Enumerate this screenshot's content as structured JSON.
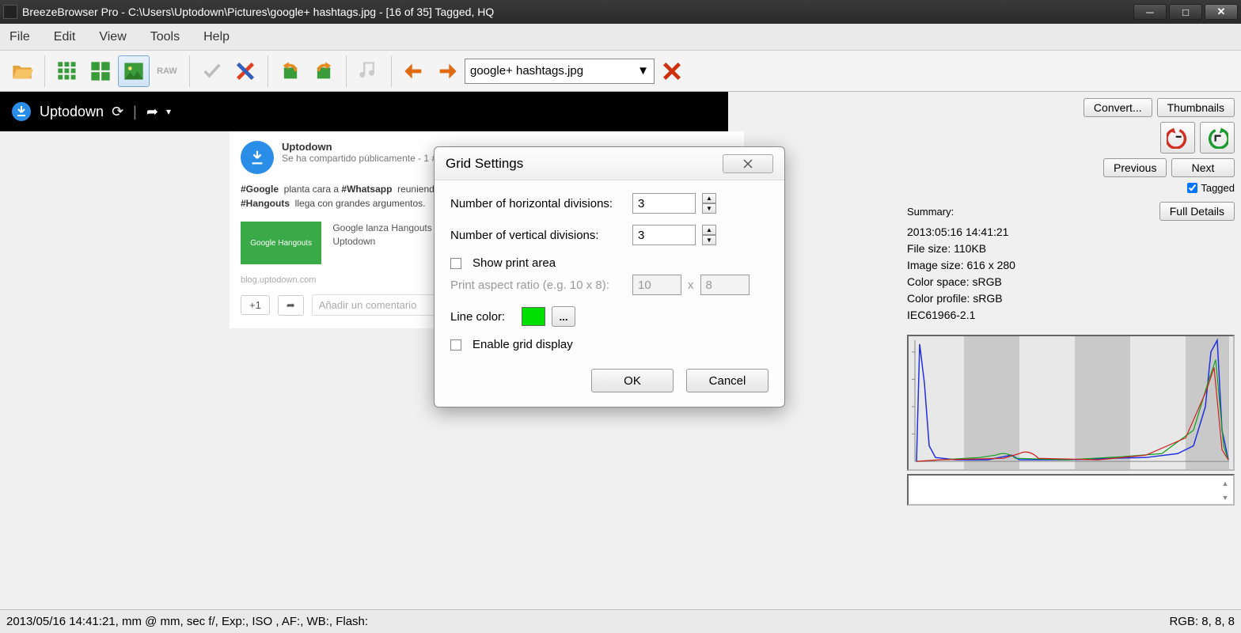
{
  "window": {
    "title": "BreezeBrowser Pro - C:\\Users\\Uptodown\\Pictures\\google+ hashtags.jpg - [16 of 35] Tagged, HQ"
  },
  "menu": {
    "file": "File",
    "edit": "Edit",
    "view": "View",
    "tools": "Tools",
    "help": "Help"
  },
  "toolbar": {
    "current_file": "google+ hashtags.jpg"
  },
  "header_black": {
    "source": "Uptodown"
  },
  "post": {
    "name": "Uptodown",
    "shared": "Se ha compartido públicamente  -  1  #",
    "body_html": "#Google  planta cara a #Whatsapp  reuniendo en una sola aplicación todos sus servicios de mensajería. #Hangouts  llega con grandes argumentos.",
    "link_title": "Google lanza Hangouts su nuevo servicio de mensajería instantánea unificada | Blog de Uptodown",
    "link_thumb_text": "Google Hangouts",
    "link_src": "blog.uptodown.com",
    "plusone": "+1",
    "comment_placeholder": "Añadir un comentario"
  },
  "side": {
    "convert": "Convert...",
    "thumbnails": "Thumbnails",
    "previous": "Previous",
    "next": "Next",
    "tagged_label": "Tagged",
    "tagged_checked": true,
    "summary_label": "Summary:",
    "full_details": "Full Details",
    "details": {
      "datetime": "2013:05:16 14:41:21",
      "filesize": "File size: 110KB",
      "imagesize": "Image size: 616 x 280",
      "colorspace": "Color space: sRGB",
      "colorprofile": "Color profile: sRGB",
      "iec": "IEC61966-2.1"
    }
  },
  "dialog": {
    "title": "Grid Settings",
    "hdiv_label": "Number of horizontal divisions:",
    "hdiv_value": "3",
    "vdiv_label": "Number of vertical divisions:",
    "vdiv_value": "3",
    "show_print_label": "Show print area",
    "aspect_label": "Print aspect ratio (e.g. 10 x 8):",
    "aspect_w": "10",
    "aspect_x": "x",
    "aspect_h": "8",
    "line_color_label": "Line color:",
    "line_color": "#00e000",
    "pick": "...",
    "enable_grid_label": "Enable grid display",
    "ok": "OK",
    "cancel": "Cancel"
  },
  "status": {
    "left": "2013/05/16 14:41:21, mm @ mm, sec f/, Exp:, ISO , AF:, WB:, Flash:",
    "right": "RGB:  8, 8, 8"
  }
}
